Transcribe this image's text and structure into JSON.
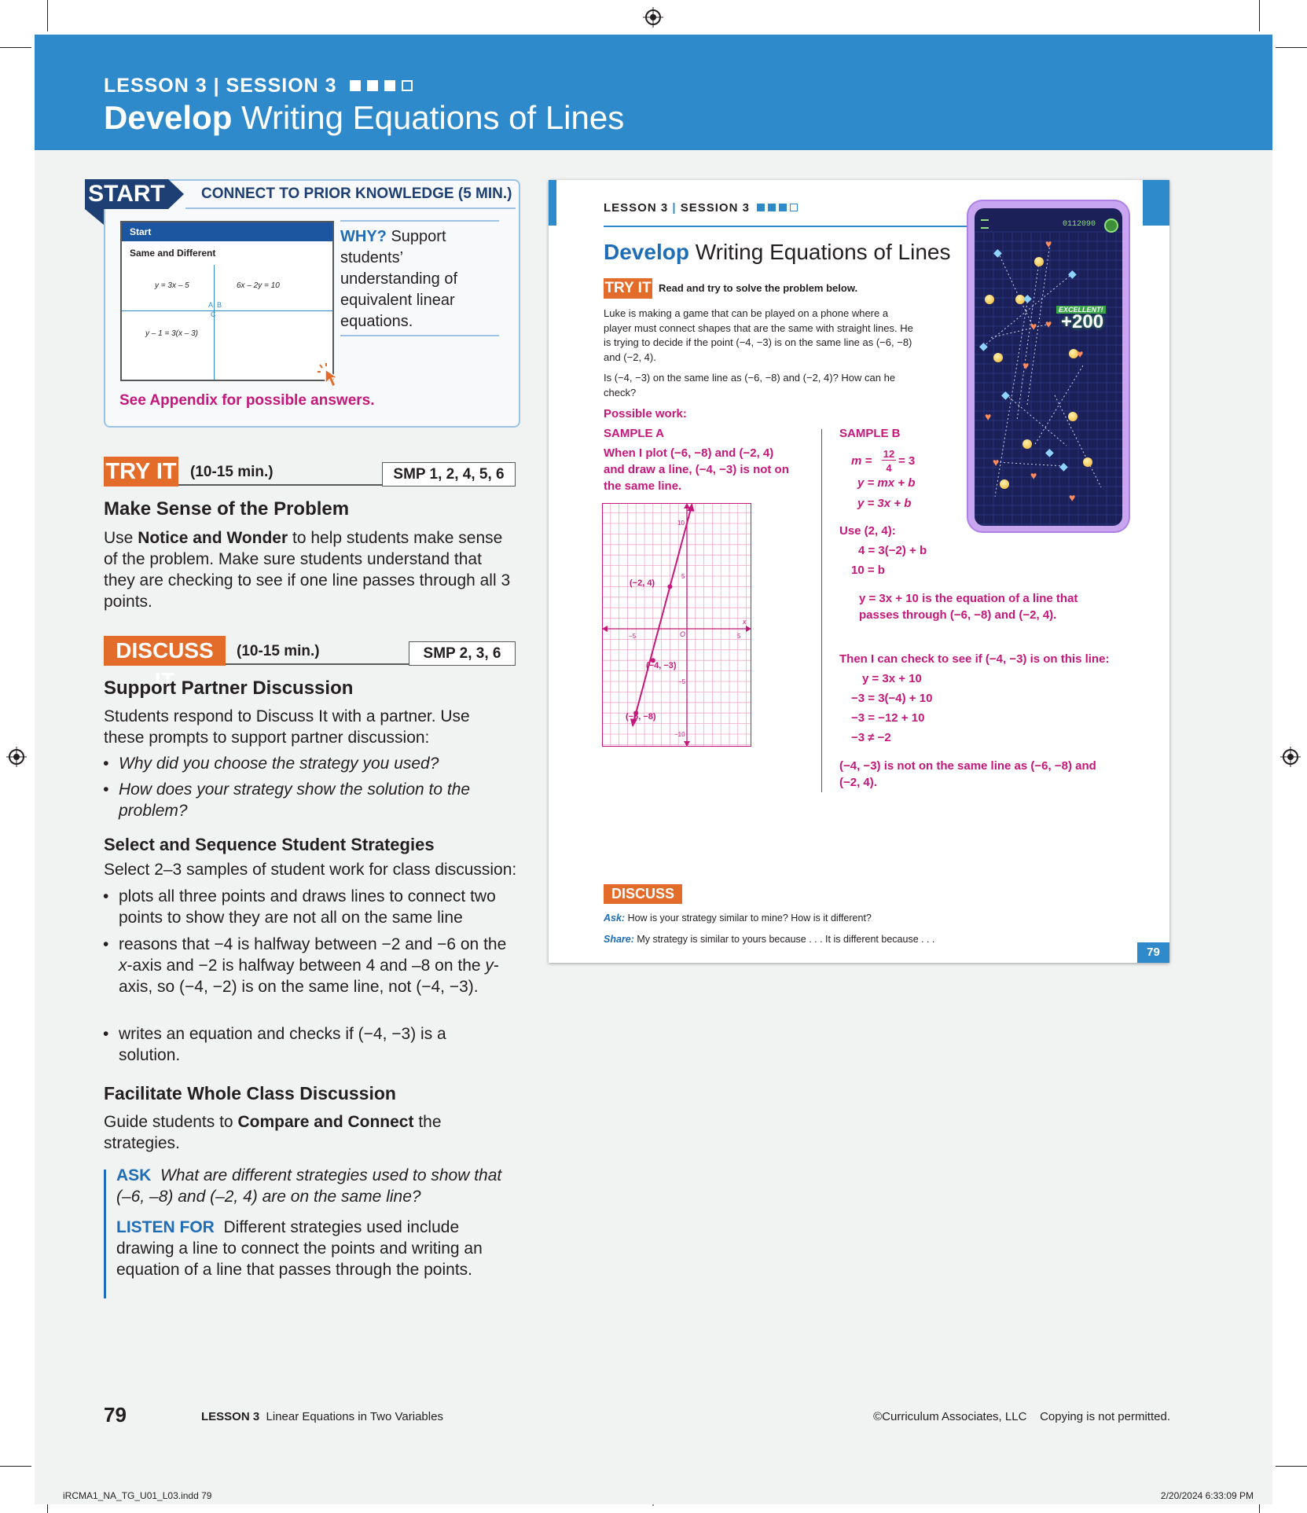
{
  "header": {
    "lesson": "LESSON 3",
    "session": "SESSION 3",
    "title_bold": "Develop",
    "title_rest": "Writing Equations of Lines"
  },
  "start": {
    "tag": "START",
    "heading": "CONNECT TO PRIOR KNOWLEDGE (5 MIN.)",
    "thumb_bar": "Start",
    "thumb_title": "Same and Different",
    "eq1": "y = 3x – 5",
    "eq2": "6x – 2y = 10",
    "eq3": "y – 1 = 3(x – 3)",
    "label_a": "A",
    "label_b": "B",
    "label_c": "C",
    "why_label": "WHY?",
    "why_text": "Support students’ understanding of equivalent linear equations.",
    "see_appendix": "See Appendix for possible answers."
  },
  "try_it": {
    "tag": "TRY IT",
    "time": "(10-15 min.)",
    "smp": "SMP 1, 2, 4, 5, 6",
    "heading": "Make Sense of the Problem",
    "p_start": "Use ",
    "p_bold": "Notice and Wonder",
    "p_end": " to help students make sense of the problem. Make sure students understand that they are checking to see if one line passes through all 3 points."
  },
  "discuss_it": {
    "tag": "DISCUSS IT",
    "time": "(10-15 min.)",
    "smp": "SMP 2, 3, 6",
    "h1": "Support Partner Discussion",
    "p1": "Students respond to Discuss It with a partner. Use these prompts to support partner discussion:",
    "prompts": [
      "Why did you choose the strategy you used?",
      "How does your strategy show the solution to the problem?"
    ],
    "h2": "Select and Sequence Student Strategies",
    "p2": "Select 2–3 samples of student work for class discussion:",
    "s1": "plots all three points and draws lines to connect two points to show they are not all on the same line",
    "s2a": "reasons that −4 is halfway between −2 and −6 on the ",
    "s2x": "x",
    "s2b": "-axis and  −2 is halfway between 4 and –8 on the ",
    "s2y": "y",
    "s2c": "-axis, so (−4, −2) is on the same line, not (−4, −3).",
    "s3": "writes an equation and checks if (−4, −3) is a solution.",
    "h3": "Facilitate Whole Class Discussion",
    "p3a": "Guide students to ",
    "p3b": "Compare and Connect",
    "p3c": " the strategies.",
    "ask_k": "ASK",
    "ask_t": "What are different strategies used to show that (–6, –8) and (–2, 4) are on the same line?",
    "listen_k": "LISTEN FOR",
    "listen_t": "Different strategies used include drawing a line to connect the points and writing an equation of a line that passes through the points."
  },
  "student_page": {
    "hdr_lesson": "LESSON 3",
    "hdr_session": "SESSION 3",
    "title_bold": "Develop",
    "title_rest": "Writing Equations of Lines",
    "try_tag": "TRY IT",
    "try_label": "Read and try to solve the problem below.",
    "problem": "Luke is making a game that can be played on a phone where a player must connect shapes that are the same with straight lines. He is trying to decide if the point (−4, −3) is on the same line as (−6, −8) and (−2, 4).",
    "question": "Is (−4, −3) on the same line as (−6, −8) and (−2, 4)? How can he check?",
    "possible": "Possible work:",
    "sample_a": "SAMPLE A",
    "sample_a_text": "When I plot (−6, −8) and (−2, 4) and draw a line, (−4, −3) is not on the same line.",
    "sample_b": "SAMPLE B",
    "m_lhs": "m =",
    "m_num": "12",
    "m_den": "4",
    "m_rhs": "= 3",
    "b1": "y = mx + b",
    "b2": "y = 3x + b",
    "use": "Use (2, 4):",
    "b3": "4 = 3(−2) + b",
    "b4": "10 = b",
    "b5": "y = 3x + 10 is the equation of a line that passes through (−6, −8) and (−2, 4).",
    "b6": "Then I can check to see if (−4, −3) is on this line:",
    "c1": "y = 3x + 10",
    "c2": "−3 = 3(−4) + 10",
    "c3": "−3 = −12 + 10",
    "c4": "−3 ≠ −2",
    "conclusion": "(−4, −3) is not on the same line as (−6, −8) and (−2, 4).",
    "graph": {
      "p1": "(−2, 4)",
      "p2": "(−4, −3)",
      "p3": "(−6, −8)",
      "t10": "10",
      "t5": "5",
      "tn5": "−5",
      "tn10": "−10",
      "o": "O",
      "x5": "5",
      "xn5": "−5",
      "xlab": "x"
    },
    "disc_tag": "DISCUSS IT",
    "ask_label": "Ask:",
    "ask_text": "How is your strategy similar to mine? How is it different?",
    "share_label": "Share:",
    "share_text": "My strategy is similar to yours because . . . It is different because . . .",
    "page_num": "79",
    "phone_score": "0112090",
    "phone_excellent": "EXCELLENT!",
    "phone_points": "+200"
  },
  "footer": {
    "page_num": "79",
    "lesson": "LESSON 3",
    "lesson_title": "Linear Equations in Two Variables",
    "copyright": "©Curriculum Associates, LLC    Copying is not permitted.",
    "slug_left": "iRCMA1_NA_TG_U01_L03.indd   79",
    "slug_right": "2/20/2024   6:33:09 PM"
  },
  "colors": {
    "header_blue": "#2f8acb",
    "navy": "#1d3f73",
    "orange": "#e46c2a",
    "magenta": "#c4177c",
    "link_blue": "#1f6db6"
  }
}
